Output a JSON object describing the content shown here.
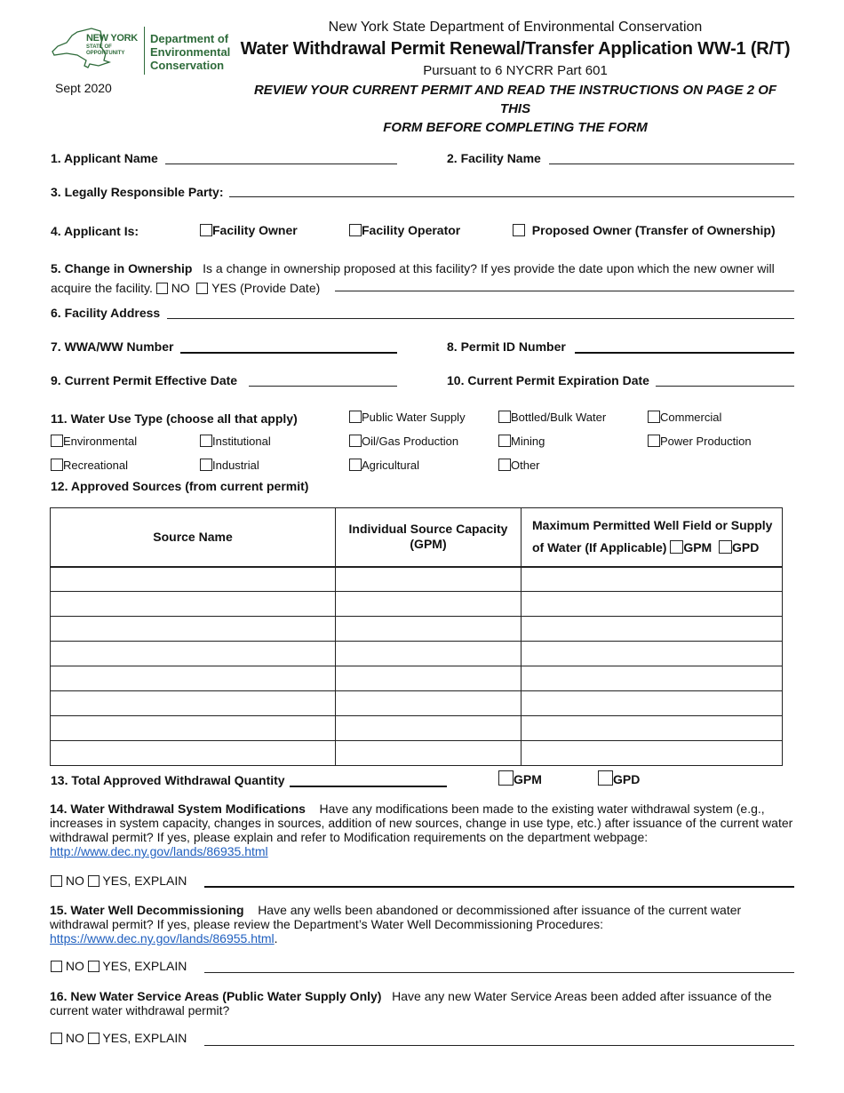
{
  "header": {
    "logo": {
      "state_line1": "NEW YORK",
      "state_line2": "STATE OF",
      "state_line3": "OPPORTUNITY",
      "dept_line1": "Department of",
      "dept_line2": "Environmental",
      "dept_line3": "Conservation",
      "brand_color": "#2e6b3a"
    },
    "date": "Sept 2020",
    "agency": "New York State Department of Environmental Conservation",
    "title": "Water Withdrawal Permit Renewal/Transfer Application WW-1 (R/T)",
    "pursuant": "Pursuant to 6 NYCRR Part 601",
    "review_line1": "REVIEW YOUR CURRENT PERMIT AND READ THE INSTRUCTIONS ON PAGE 2 OF THIS",
    "review_line2": "FORM BEFORE COMPLETING THE FORM"
  },
  "fields": {
    "q1": {
      "label": "1.  Applicant Name",
      "value": ""
    },
    "q2": {
      "label": "2.  Facility Name",
      "value": ""
    },
    "q3": {
      "label": "3.  Legally Responsible Party:",
      "value": ""
    },
    "q4": {
      "label": "4.  Applicant Is:",
      "options": [
        "Facility Owner",
        "Facility Operator",
        "Proposed Owner (Transfer of Ownership)"
      ]
    },
    "q5": {
      "label": "5.  Change in Ownership",
      "text1": "Is a change in ownership proposed at this facility? If yes provide the date upon which the new owner will",
      "text2": "acquire the facility.",
      "no": "NO",
      "yes": "YES (Provide Date)",
      "value": ""
    },
    "q6": {
      "label": "6.  Facility Address",
      "value": ""
    },
    "q7": {
      "label": "7.  WWA/WW Number",
      "value": ""
    },
    "q8": {
      "label": "8.  Permit ID Number",
      "value": ""
    },
    "q9": {
      "label": "9.  Current Permit Effective Date",
      "value": ""
    },
    "q10": {
      "label": "10.  Current Permit Expiration Date",
      "value": ""
    },
    "q11": {
      "label": "11.  Water Use Type (choose all that apply)",
      "options": [
        "Public Water Supply",
        "Bottled/Bulk Water",
        "Commercial",
        "Environmental",
        "Institutional",
        "Oil/Gas Production",
        "Mining",
        "Power Production",
        "Recreational",
        "Industrial",
        "Agricultural",
        "Other"
      ]
    },
    "q12": {
      "label": "12.  Approved Sources (from current permit)",
      "columns": [
        "Source Name",
        "Individual Source Capacity (GPM)",
        "Maximum Permitted Well Field or Supply of Water (If Applicable)"
      ],
      "col3_line1": "Maximum Permitted Well Field or Supply",
      "col3_line2": "of Water (If Applicable)",
      "col2_line1": "Individual Source Capacity",
      "col2_line2": "(GPM)",
      "unit_options": [
        "GPM",
        "GPD"
      ],
      "rows": [
        [
          "",
          "",
          ""
        ],
        [
          "",
          "",
          ""
        ],
        [
          "",
          "",
          ""
        ],
        [
          "",
          "",
          ""
        ],
        [
          "",
          "",
          ""
        ],
        [
          "",
          "",
          ""
        ],
        [
          "",
          "",
          ""
        ],
        [
          "",
          "",
          ""
        ]
      ]
    },
    "q13": {
      "label": "13. Total Approved Withdrawal Quantity",
      "value": "",
      "unit_options": [
        "GPM",
        "GPD"
      ]
    },
    "q14": {
      "label": "14. Water Withdrawal System Modifications",
      "text": "Have any modifications been made to the existing water withdrawal system (e.g., increases in system capacity, changes in sources, addition of new sources, change in use type, etc.) after issuance of the current water withdrawal permit? If yes, please explain and refer to Modification requirements on the department webpage:",
      "link": "http://www.dec.ny.gov/lands/86935.html",
      "no": "NO",
      "yes": "YES, EXPLAIN",
      "value": ""
    },
    "q15": {
      "label": "15. Water Well Decommissioning",
      "text": "Have any wells been abandoned or decommissioned after issuance of the current water withdrawal permit? If yes, please review the Department’s Water Well Decommissioning Procedures:",
      "link": "https://www.dec.ny.gov/lands/86955.html",
      "link_suffix": ".",
      "no": "NO",
      "yes": "YES, EXPLAIN",
      "value": ""
    },
    "q16": {
      "label": "16. New Water Service Areas (Public Water Supply Only)",
      "text": "Have any new Water Service Areas been added after issuance of the current water withdrawal permit?",
      "no": "NO",
      "yes": "YES, EXPLAIN",
      "value": ""
    }
  },
  "colors": {
    "link": "#1f5fbf",
    "text": "#111111",
    "logo_green": "#2e6b3a"
  }
}
